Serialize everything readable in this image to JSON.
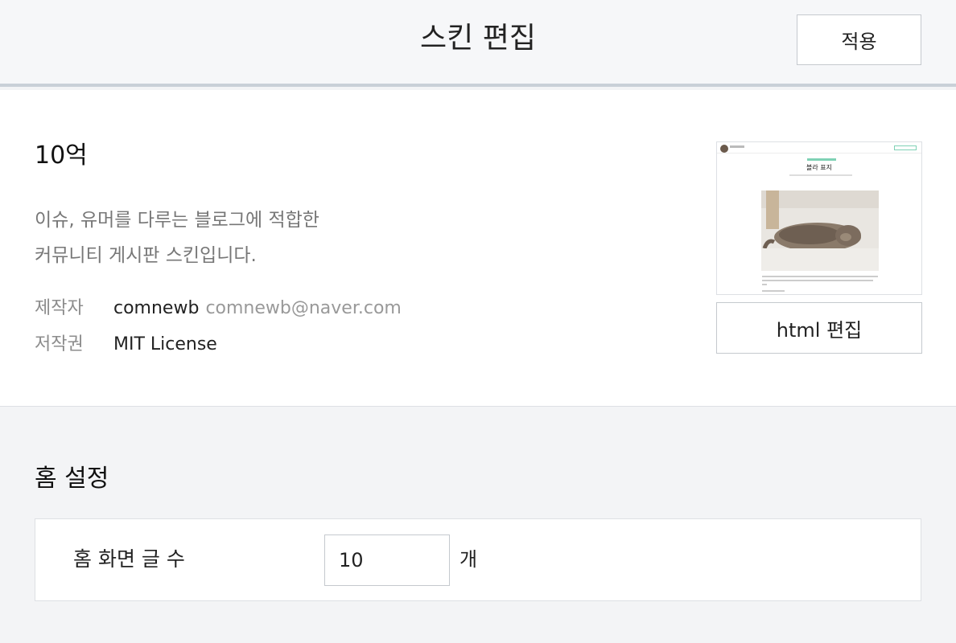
{
  "header": {
    "title": "스킨 편집",
    "apply_label": "적용"
  },
  "skin": {
    "name": "10억",
    "description_line1": "이슈, 유머를 다루는 블로그에 적합한",
    "description_line2": "커뮤니티 게시판 스킨입니다.",
    "author_label": "제작자",
    "author_name": "comnewb",
    "author_email": "comnewb@naver.com",
    "license_label": "저작권",
    "license_value": "MIT License",
    "html_edit_label": "html 편집",
    "preview_title": "블라 표지"
  },
  "home_settings": {
    "title": "홈 설정",
    "post_count_label": "홈 화면 글 수",
    "post_count_value": "10",
    "unit": "개"
  },
  "colors": {
    "header_bg": "#f6f7f9",
    "header_border": "#c9d0d8",
    "page_bg": "#f3f4f6",
    "accent": "#7fd1b5",
    "muted_text": "#777777"
  }
}
